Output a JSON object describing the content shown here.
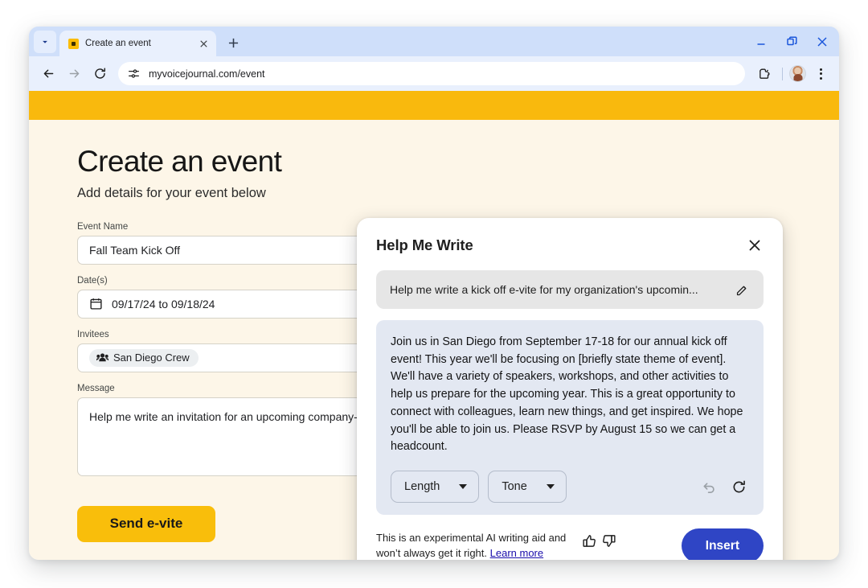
{
  "browser": {
    "tab": {
      "title": "Create an event",
      "favicon_name": "event-favicon",
      "close_label": "Close tab"
    },
    "tab_search_label": "Search tabs",
    "new_tab_label": "New tab",
    "window_controls": {
      "minimize": "Minimize",
      "restore": "Restore",
      "close": "Close"
    },
    "toolbar": {
      "back": "Back",
      "forward": "Forward",
      "reload": "Reload",
      "url": "myvoicejournal.com/event",
      "site_settings_icon": "tune-icon",
      "extensions": "Extensions",
      "profile": "Profile",
      "menu": "Customize and control"
    }
  },
  "page": {
    "title": "Create an event",
    "subtitle": "Add details for your event below",
    "fields": {
      "event_name": {
        "label": "Event Name",
        "value": "Fall Team Kick Off"
      },
      "dates": {
        "label": "Date(s)",
        "value": "09/17/24 to 09/18/24",
        "icon": "calendar-icon"
      },
      "invitees": {
        "label": "Invitees",
        "chip": "San Diego Crew",
        "icon": "groups-icon"
      },
      "message": {
        "label": "Message",
        "value": "Help me write an invitation for an upcoming company-wide"
      }
    },
    "send_button": "Send e-vite",
    "accent_yellow": "#f9b90d",
    "background_cream": "#fdf6e8"
  },
  "dialog": {
    "title": "Help Me Write",
    "close_label": "Close",
    "prompt": "Help me write a kick off e-vite for my organization's upcomin...",
    "edit_icon": "pencil-icon",
    "result": "Join us in San Diego from September 17-18 for our annual kick off event! This year we'll be focusing on [briefly state theme of event]. We'll have a variety of speakers, workshops, and other activities to help us prepare for the upcoming year. This is a great opportunity to connect with colleagues, learn new things, and get inspired. We hope you'll be able to join us. Please RSVP by August 15 so we can get a headcount.",
    "controls": {
      "length": "Length",
      "tone": "Tone",
      "undo_icon": "undo-icon",
      "refresh_icon": "refresh-icon"
    },
    "footer": {
      "disclaimer_line1": "This is an experimental AI writing aid and",
      "disclaimer_line2": "won’t always get it right.",
      "learn_more": "Learn more",
      "thumbs_up_icon": "thumb-up-icon",
      "thumbs_down_icon": "thumb-down-icon",
      "insert": "Insert",
      "insert_color": "#2f45c5"
    }
  }
}
